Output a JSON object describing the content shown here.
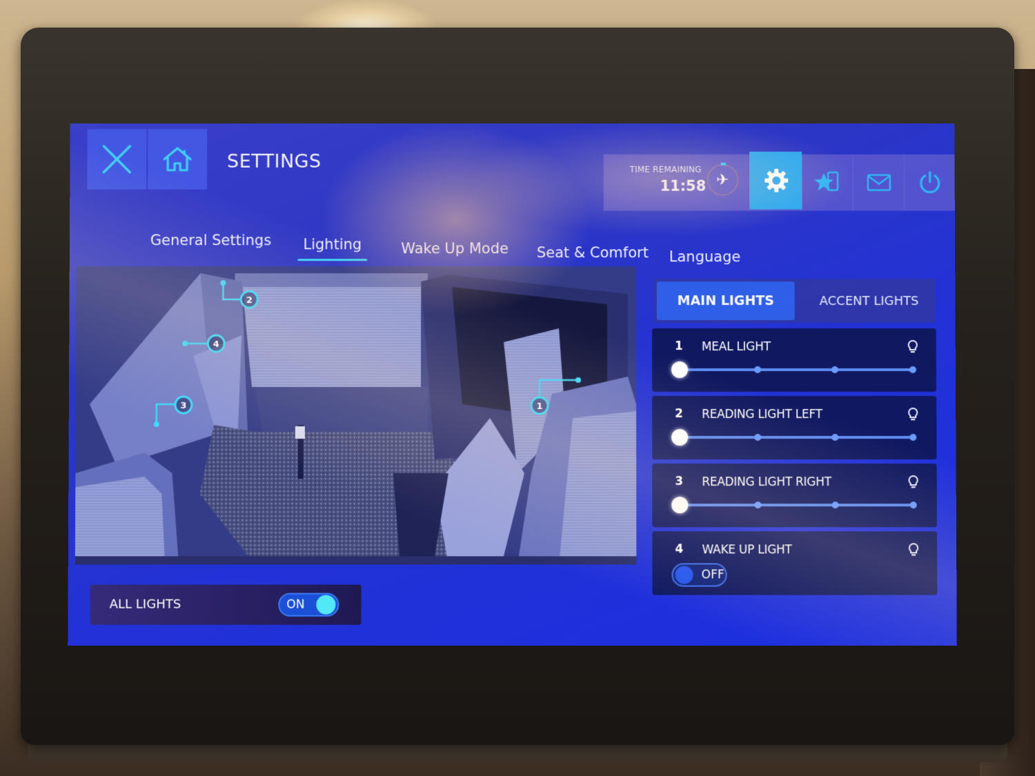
{
  "header": {
    "title": "SETTINGS",
    "close_icon": "close-x-icon",
    "home_icon": "home-icon"
  },
  "status": {
    "time_remaining_label": "TIME REMAINING",
    "time_remaining_value": "11:58",
    "flight_icon": "airplane-icon",
    "flight_glyph": "✈"
  },
  "toolbar": {
    "items": [
      {
        "name": "settings",
        "icon": "gear-icon",
        "active": true
      },
      {
        "name": "favorites",
        "icon": "star-device-icon",
        "active": false
      },
      {
        "name": "messages",
        "icon": "mail-icon",
        "active": false
      },
      {
        "name": "power",
        "icon": "power-icon",
        "active": false
      }
    ]
  },
  "tabs": [
    {
      "label": "General Settings",
      "active": false
    },
    {
      "label": "Lighting",
      "active": true
    },
    {
      "label": "Wake Up Mode",
      "active": false
    },
    {
      "label": "Seat & Comfort",
      "active": false
    },
    {
      "label": "Language",
      "active": false
    }
  ],
  "light_tabs": {
    "main": "MAIN LIGHTS",
    "accent": "ACCENT LIGHTS",
    "active": "main"
  },
  "lights": [
    {
      "number": "1",
      "name": "MEAL LIGHT",
      "type": "slider",
      "level": 0,
      "levels": 4
    },
    {
      "number": "2",
      "name": "READING LIGHT LEFT",
      "type": "slider",
      "level": 0,
      "levels": 4
    },
    {
      "number": "3",
      "name": "READING LIGHT RIGHT",
      "type": "slider",
      "level": 0,
      "levels": 4
    },
    {
      "number": "4",
      "name": "WAKE UP LIGHT",
      "type": "toggle",
      "state": "OFF"
    }
  ],
  "seat_markers": [
    {
      "number": "1"
    },
    {
      "number": "2"
    },
    {
      "number": "3"
    },
    {
      "number": "4"
    }
  ],
  "all_lights": {
    "label": "ALL LIGHTS",
    "state": "ON"
  },
  "colors": {
    "accent_cyan": "#3ed4f5",
    "active_tab_bg": "#29a9f2",
    "main_lights_bg": "#2f5fe6",
    "screen_blue": "#2232d6"
  }
}
